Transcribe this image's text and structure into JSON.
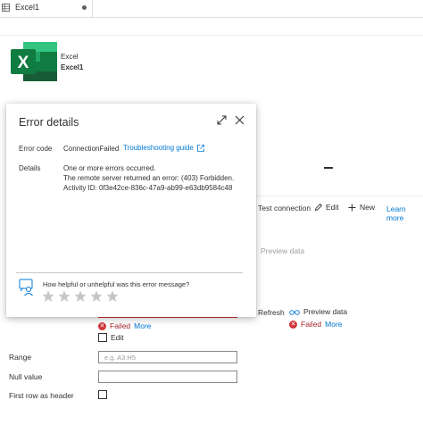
{
  "tab": {
    "label": "Excel1"
  },
  "header": {
    "app": "Excel",
    "name": "Excel1"
  },
  "toolbar": {
    "test_connection": "Test connection",
    "edit": "Edit",
    "new": "New",
    "learn_more": "Learn more",
    "preview_data_disabled": "Preview data"
  },
  "actions": {
    "refresh": "Refresh",
    "preview_data": "Preview data"
  },
  "status": {
    "failed": "Failed",
    "more": "More"
  },
  "edit_checkbox": {
    "label": "Edit"
  },
  "form": {
    "range_label": "Range",
    "range_placeholder": "e.g. A3:H5",
    "null_value_label": "Null value",
    "first_row_label": "First row as header"
  },
  "dialog": {
    "title": "Error details",
    "error_code_label": "Error code",
    "error_code_value": "ConnectionFailed",
    "troubleshooting": "Troubleshooting guide",
    "details_label": "Details",
    "details_line1": "One or more errors occurred.",
    "details_line2": "The remote server returned an error: (403) Forbidden.",
    "details_line3": "Activity ID: 0f3e42ce-836c-47a9-ab99-e63db9584c48",
    "feedback_question": "How helpful or unhelpful was this error message?",
    "rating": 0,
    "rating_max": 5
  },
  "colors": {
    "accent": "#0078d4",
    "error": "#d13438",
    "excel_dark": "#185c37",
    "excel_mid": "#107c41",
    "excel_light": "#21a366"
  },
  "icons": {
    "tab": "grid-icon",
    "logo": "excel-logo-icon",
    "edit": "pencil-icon",
    "new": "plus-icon",
    "preview": "glasses-icon",
    "failed": "error-circle-icon",
    "expand": "expand-icon",
    "close": "close-icon",
    "external": "external-link-icon",
    "feedback": "feedback-person-icon",
    "star": "star-icon"
  }
}
